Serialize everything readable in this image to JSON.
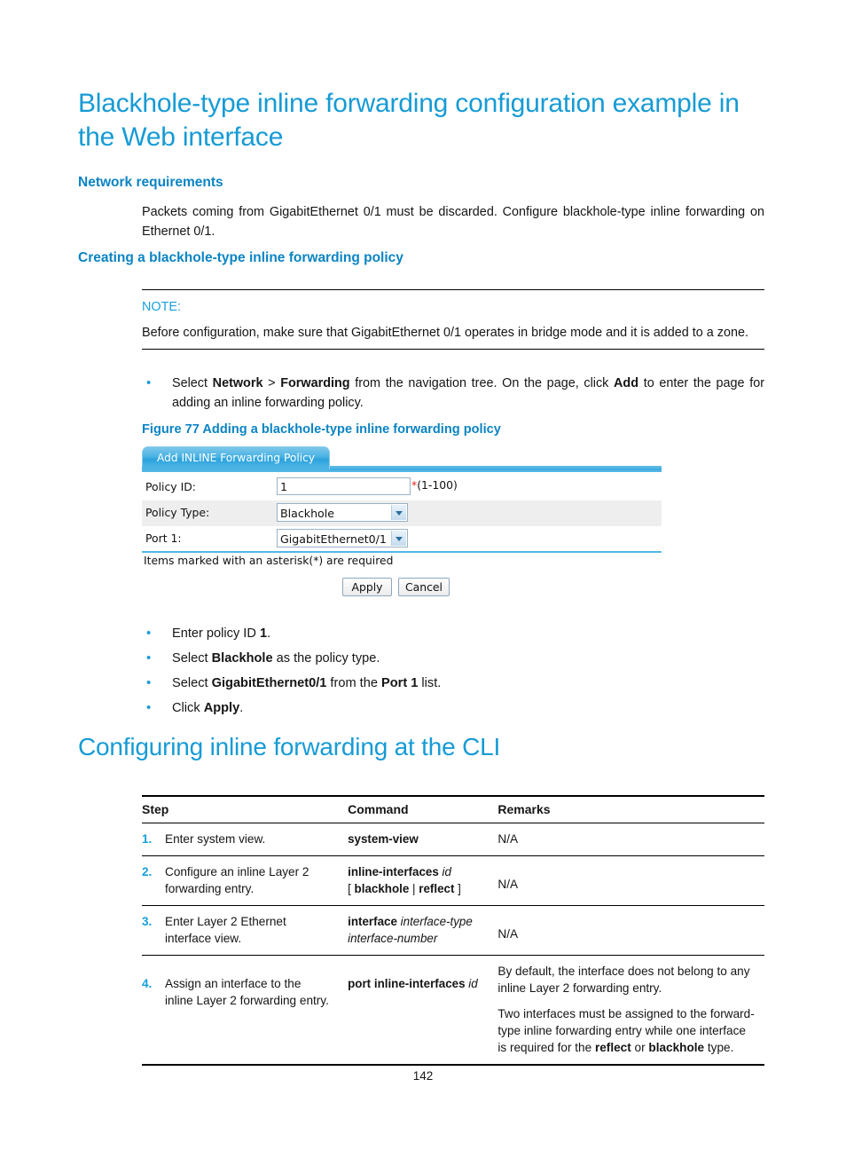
{
  "headings": {
    "h1_main": "Blackhole-type inline forwarding configuration example in the Web interface",
    "h2_network_requirements": "Network requirements",
    "h2_creating_policy": "Creating a blackhole-type inline forwarding policy",
    "h1_cli": "Configuring inline forwarding at the CLI"
  },
  "paragraphs": {
    "requirements": "Packets coming from GigabitEthernet 0/1 must be discarded. Configure blackhole-type inline forwarding on Ethernet 0/1."
  },
  "note": {
    "label": "NOTE:",
    "text": "Before configuration, make sure that GigabitEthernet 0/1 operates in bridge mode and it is added to a zone."
  },
  "nav_bullet": {
    "prefix": "Select ",
    "bold1": "Network",
    "sep": " > ",
    "bold2": "Forwarding",
    "middle": " from the navigation tree. On the page, click ",
    "bold3": "Add",
    "suffix": " to enter the page for adding an inline forwarding policy."
  },
  "figure": {
    "caption": "Figure 77 Adding a blackhole-type inline forwarding policy",
    "tab_label": "Add INLINE Forwarding Policy",
    "fields": [
      {
        "label": "Policy ID:",
        "value": "1",
        "hint": "(1-100)",
        "required": true,
        "type": "text"
      },
      {
        "label": "Policy Type:",
        "value": "Blackhole",
        "type": "select"
      },
      {
        "label": "Port 1:",
        "value": "GigabitEthernet0/1",
        "type": "select"
      }
    ],
    "asterisk_note": "Items marked with an asterisk(*) are required",
    "buttons": {
      "apply": "Apply",
      "cancel": "Cancel"
    },
    "colors": {
      "tab_blue": "#3aa9e0",
      "rule_blue": "#53b6e6",
      "row_alt": "#eeeeee",
      "required_red": "#e0231b"
    }
  },
  "steps_bullets": [
    {
      "prefix": "Enter policy ID ",
      "bold": "1",
      "suffix": "."
    },
    {
      "prefix": "Select ",
      "bold": "Blackhole",
      "suffix": " as the policy type."
    },
    {
      "prefix": "Select ",
      "bold": "GigabitEthernet0/1",
      "suffix": " from the ",
      "bold2": "Port 1",
      "suffix2": " list."
    },
    {
      "prefix": "Click ",
      "bold": "Apply",
      "suffix": "."
    }
  ],
  "cli_table": {
    "headers": {
      "step": "Step",
      "command": "Command",
      "remarks": "Remarks"
    },
    "rows": [
      {
        "num": "1.",
        "step": "Enter system view.",
        "command_html": "<b>system-view</b>",
        "remarks_html": "<p>N/A</p>"
      },
      {
        "num": "2.",
        "step": "Configure an inline Layer 2 forwarding entry.",
        "command_html": "<b>inline-interfaces</b> <i>id</i><br>[ <b>blackhole</b> | <b>reflect</b> ]",
        "remarks_html": "<p>N/A</p>"
      },
      {
        "num": "3.",
        "step": "Enter Layer 2 Ethernet interface view.",
        "command_html": "<b>interface</b> <i>interface-type interface-number</i>",
        "remarks_html": "<p>N/A</p>"
      },
      {
        "num": "4.",
        "step": "Assign an interface to the inline Layer 2 forwarding entry.",
        "command_html": "<b>port inline-interfaces</b> <i>id</i>",
        "remarks_html": "<p>By default, the interface does not belong to any inline Layer 2 forwarding entry.</p><p>Two interfaces must be assigned to the forward-type inline forwarding entry while one interface is required for the <b>reflect</b> or <b>blackhole</b> type.</p>"
      }
    ]
  },
  "footer": {
    "page_number": "142"
  },
  "theme": {
    "heading_blue": "#169bd5",
    "subheading_blue": "#0a84c4",
    "bullet_blue": "#1f9ad6",
    "step_number_blue": "#16a0db"
  }
}
